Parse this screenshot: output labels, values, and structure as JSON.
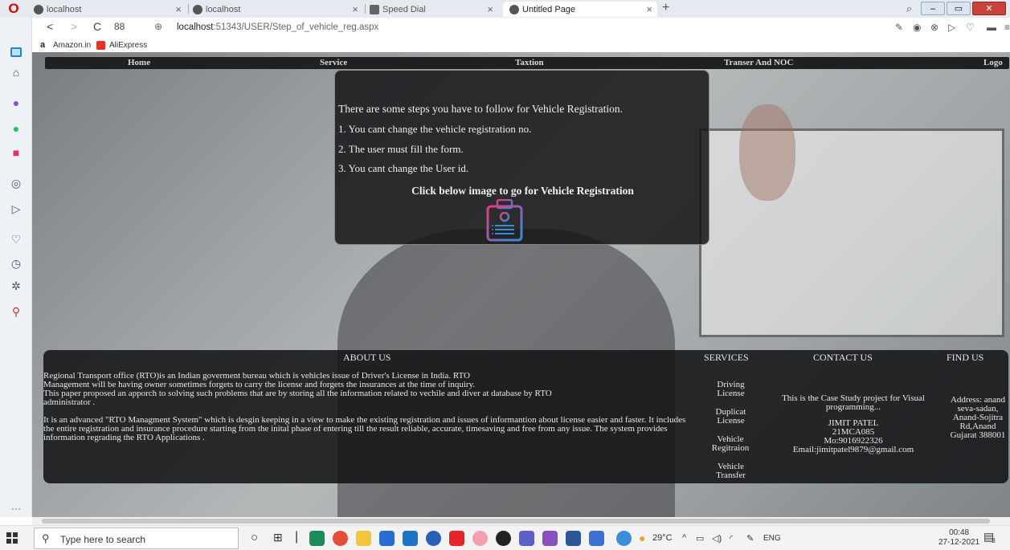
{
  "browser": {
    "tabs": [
      {
        "label": "localhost",
        "active": false
      },
      {
        "label": "localhost",
        "active": false
      },
      {
        "label": "Speed Dial",
        "active": false
      },
      {
        "label": "Untitled Page",
        "active": true
      }
    ],
    "close_glyph": "×",
    "new_tab_glyph": "+",
    "opera_logo": "O",
    "url_host": "localhost",
    "url_path": ":51343/USER/Step_of_vehicle_reg.aspx",
    "speed_dial_count": "88",
    "bookmarks": [
      {
        "label": "Amazon.in",
        "icon": "amazon-icon"
      },
      {
        "label": "AliExpress",
        "icon": "aliexpress-icon"
      }
    ]
  },
  "site": {
    "nav": [
      "Home",
      "Service",
      "Taxtion",
      "Transer And NOC",
      "Logo"
    ],
    "info": {
      "heading": "There are some steps you have to follow for Vehicle Registration.",
      "steps": [
        "1. You cant change the vehicle registration no.",
        "2. The user must fill the form.",
        "3. You cant change the User id."
      ],
      "cta": "Click below image to go for Vehicle Registration"
    },
    "footer": {
      "about_title": "ABOUT US",
      "services_title": "SERVICES",
      "contact_title": "CONTACT US",
      "findus_title": "FIND US",
      "about_paragraphs": [
        "Regional Transport office (RTO)is an Indian goverment bureau which is vehicles issue of Driver's License in India. RTO",
        "Management will be having owner sometimes forgets to carry the license and forgets the insurances at the time of inquiry.",
        "This paper proposed an apporch to solving such problems that are by storing all the information related to vechile and diver at database by RTO administrator .",
        "It is an advanced \"RTO Managment System\" which is desgin keeping in a view to make the existing registration and issues of informantion about license easier and faster. It includes the entire registration and insurance procedure starting from the inital phase of entering till the result reliable, accurate, timesaving and free from any issue. The system provides information regrading the RTO Applications ."
      ],
      "services": [
        "Driving License",
        "Duplicat License",
        "Vehicle Regitraion",
        "Vehicle Transfer"
      ],
      "contact": {
        "line1": "This is the Case Study project for Visual programming...",
        "name": "JIMIT PATEL",
        "id": "21MCA085",
        "mobile": "Mo:9016922326",
        "email": "Email:jimitpatel9879@gmail.com"
      },
      "findus": "Address: anand seva-sadan, Anand-Sojitra Rd,Anand Gujarat 388001"
    }
  },
  "taskbar": {
    "search_placeholder": "Type here to search",
    "weather": "29°C",
    "language": "ENG",
    "time": "00:48",
    "date": "27-12-2021",
    "notification_count": "3"
  },
  "colors": {
    "nav_bg": "#202020",
    "panel_bg": "#161618",
    "page_bg": "#9a9ea2",
    "accent_icon": "#3d6fd0"
  }
}
